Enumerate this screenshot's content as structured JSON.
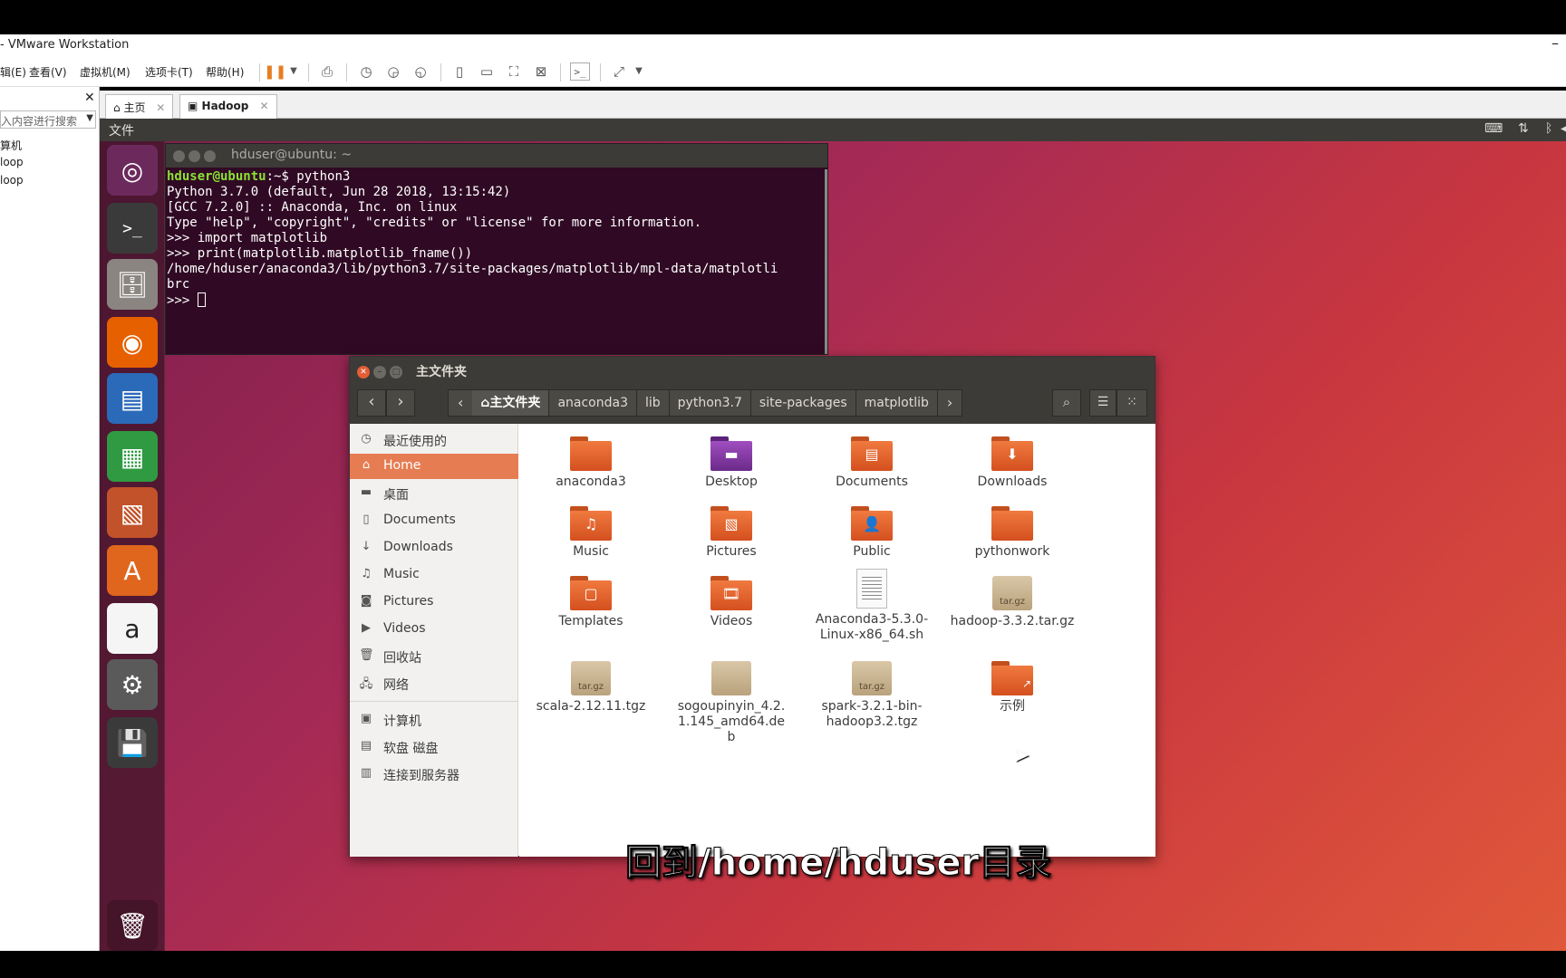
{
  "vmware": {
    "title": "- VMware Workstation",
    "menus": [
      "辑(E)",
      "查看(V)",
      "虚拟机(M)",
      "选项卡(T)",
      "帮助(H)"
    ],
    "library": {
      "search_placeholder": "入内容进行搜索",
      "tree": [
        "算机",
        "loop",
        "loop"
      ]
    },
    "tabs": [
      {
        "label": "主页"
      },
      {
        "label": "Hadoop"
      }
    ]
  },
  "guest_menu": {
    "label": "文件"
  },
  "terminal": {
    "title": "hduser@ubuntu: ~",
    "prompt_user": "hduser@ubuntu",
    "prompt_path": ":~$",
    "command": " python3",
    "lines": [
      "Python 3.7.0 (default, Jun 28 2018, 13:15:42)",
      "[GCC 7.2.0] :: Anaconda, Inc. on linux",
      "Type \"help\", \"copyright\", \"credits\" or \"license\" for more information.",
      ">>> import matplotlib",
      ">>> print(matplotlib.matplotlib_fname())",
      "/home/hduser/anaconda3/lib/python3.7/site-packages/matplotlib/mpl-data/matplotli",
      "brc"
    ],
    "final_prompt": ">>> "
  },
  "file_manager": {
    "title": "主文件夹",
    "breadcrumb": [
      "主文件夹",
      "anaconda3",
      "lib",
      "python3.7",
      "site-packages",
      "matplotlib"
    ],
    "sidebar": [
      {
        "label": "最近使用的",
        "icon": "clock-icon"
      },
      {
        "label": "Home",
        "icon": "home-icon"
      },
      {
        "label": "桌面",
        "icon": "desktop-icon"
      },
      {
        "label": "Documents",
        "icon": "document-icon"
      },
      {
        "label": "Downloads",
        "icon": "download-icon"
      },
      {
        "label": "Music",
        "icon": "music-icon"
      },
      {
        "label": "Pictures",
        "icon": "camera-icon"
      },
      {
        "label": "Videos",
        "icon": "video-icon"
      },
      {
        "label": "回收站",
        "icon": "trash-icon"
      },
      {
        "label": "网络",
        "icon": "network-icon"
      },
      {
        "label": "计算机",
        "icon": "computer-icon"
      },
      {
        "label": "软盘 磁盘",
        "icon": "floppy-icon"
      },
      {
        "label": "连接到服务器",
        "icon": "server-icon"
      }
    ],
    "files": [
      {
        "name": "anaconda3",
        "kind": "folder"
      },
      {
        "name": "Desktop",
        "kind": "desktop"
      },
      {
        "name": "Documents",
        "kind": "folder-doc"
      },
      {
        "name": "Downloads",
        "kind": "folder-down"
      },
      {
        "name": "Music",
        "kind": "folder-music"
      },
      {
        "name": "Pictures",
        "kind": "folder-pic"
      },
      {
        "name": "Public",
        "kind": "folder-user"
      },
      {
        "name": "pythonwork",
        "kind": "folder"
      },
      {
        "name": "Templates",
        "kind": "folder-tpl"
      },
      {
        "name": "Videos",
        "kind": "folder-video"
      },
      {
        "name": "Anaconda3-5.3.0-Linux-x86_64.sh",
        "kind": "doc"
      },
      {
        "name": "hadoop-3.3.2.tar.gz",
        "kind": "pkg",
        "badge": "tar.gz"
      },
      {
        "name": "scala-2.12.11.tgz",
        "kind": "pkg",
        "badge": "tar.gz"
      },
      {
        "name": "sogoupinyin_4.2.1.145_amd64.deb",
        "kind": "pkg",
        "badge": ""
      },
      {
        "name": "spark-3.2.1-bin-hadoop3.2.tgz",
        "kind": "pkg",
        "badge": "tar.gz"
      },
      {
        "name": "示例",
        "kind": "folder-link"
      }
    ]
  },
  "subtitle": "回到/home/hduser目录"
}
